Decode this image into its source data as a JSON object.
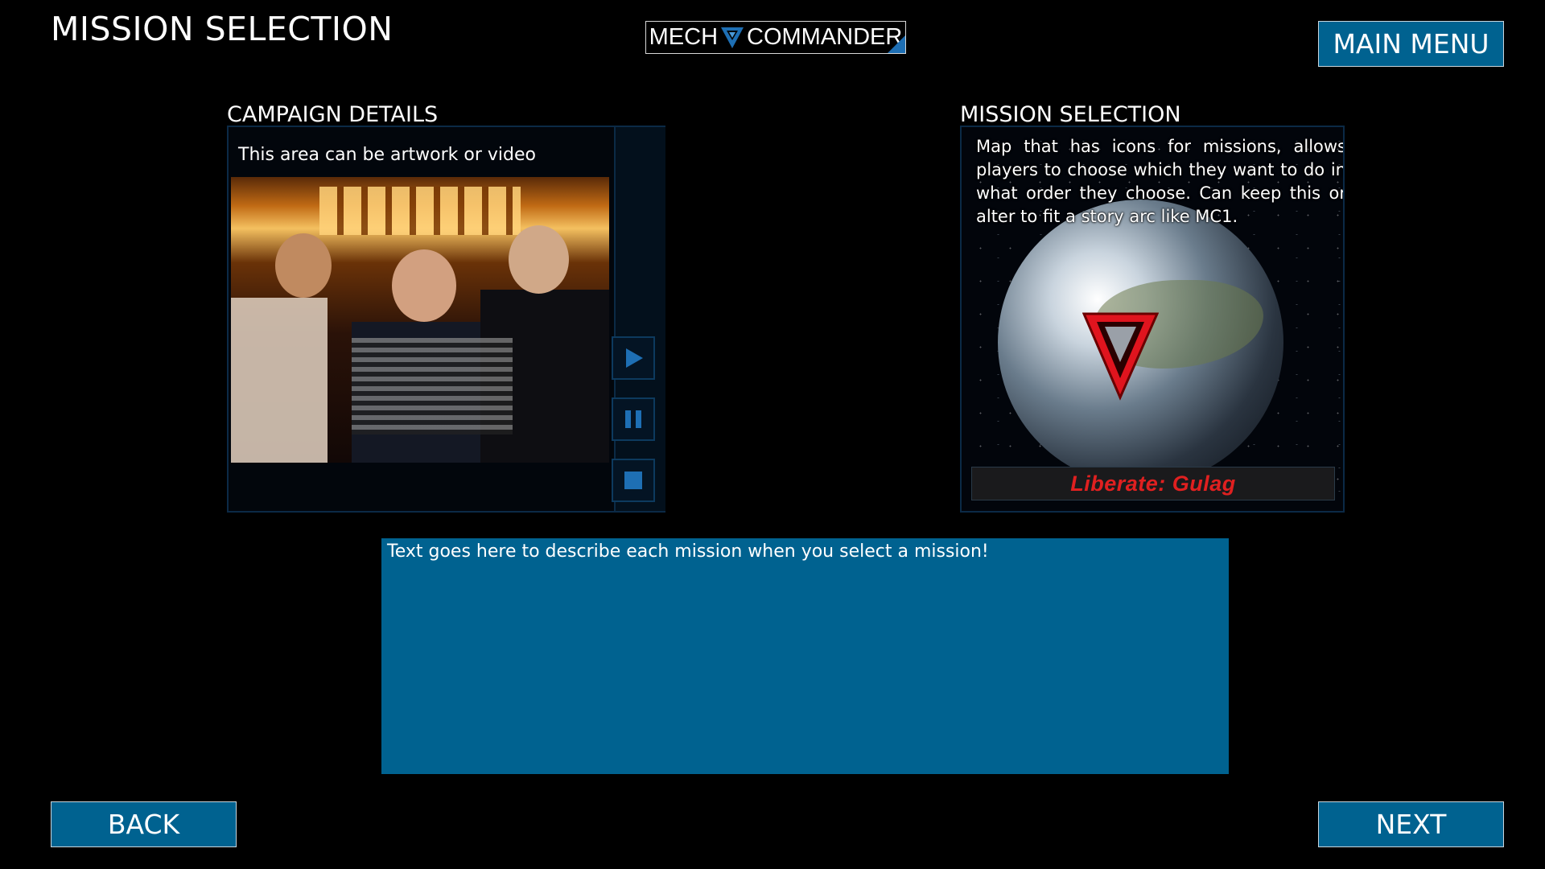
{
  "header": {
    "title": "MISSION SELECTION",
    "logo_left": "MECH",
    "logo_right": "COMMANDER",
    "main_menu_label": "MAIN MENU"
  },
  "campaign": {
    "heading": "CAMPAIGN DETAILS",
    "caption": "This area can be artwork or video",
    "controls": [
      "play-icon",
      "pause-icon",
      "stop-icon"
    ]
  },
  "mission": {
    "heading": "MISSION SELECTION",
    "description": "Map that has icons for missions, allows players to choose which they want to do in what order they choose. Can keep this or alter to fit a story arc like MC1.",
    "selected_mission": "Liberate: Gulag"
  },
  "details": {
    "text": "Text goes here to describe each mission when you select a mission!"
  },
  "footer": {
    "back_label": "BACK",
    "next_label": "NEXT"
  },
  "colors": {
    "button_fill": "#006290",
    "accent_blue": "#1e6fb4",
    "marker_red": "#e0141e",
    "background": "#000000"
  }
}
